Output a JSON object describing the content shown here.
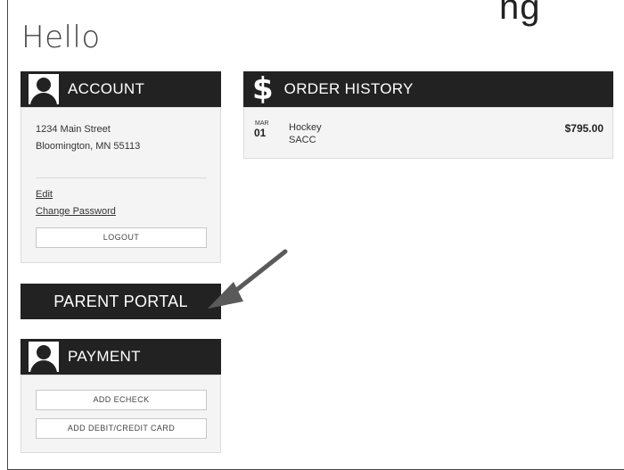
{
  "page": {
    "top_clipped_text": "ng",
    "greeting": "Hello"
  },
  "account": {
    "title": "ACCOUNT",
    "address_line1": "1234 Main Street",
    "address_line2": "Bloomington, MN 55113",
    "edit_label": "Edit",
    "change_password_label": "Change Password",
    "logout_label": "LOGOUT"
  },
  "parent_portal": {
    "label": "PARENT PORTAL"
  },
  "payment": {
    "title": "PAYMENT",
    "add_echeck_label": "ADD ECHECK",
    "add_card_label": "ADD DEBIT/CREDIT CARD"
  },
  "order_history": {
    "title": "ORDER HISTORY",
    "icon": "dollar-icon",
    "orders": [
      {
        "month": "MAR",
        "day": "01",
        "name": "Hockey",
        "sub": "SACC",
        "amount": "$795.00"
      }
    ]
  },
  "colors": {
    "header_bg": "#222222",
    "panel_bg": "#f4f4f4",
    "arrow": "#5a5a5a"
  }
}
